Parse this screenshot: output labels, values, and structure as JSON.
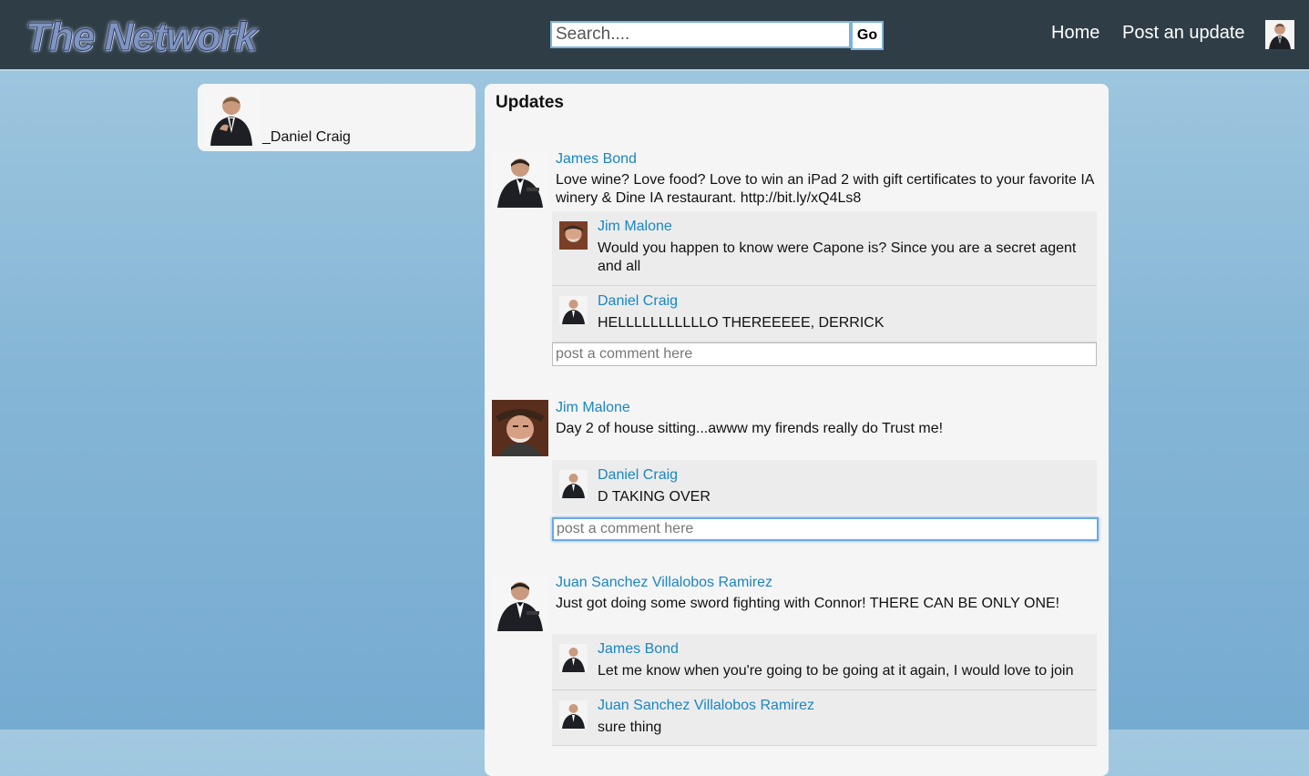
{
  "header": {
    "logo_text": "The Network",
    "search_placeholder": "Search....",
    "go_label": "Go",
    "nav_home": "Home",
    "nav_post": "Post an update",
    "avatar_icon": "user-avatar-icon"
  },
  "profile": {
    "name": "_Daniel Craig"
  },
  "updates": {
    "title": "Updates",
    "posts": [
      {
        "author": "James Bond",
        "text": "Love wine? Love food? Love to win an iPad 2 with gift certificates to your favorite IA winery & Dine IA restaurant. http://bit.ly/xQ4Ls8",
        "comments": [
          {
            "author": "Jim Malone",
            "text": "Would you happen to know were Capone is? Since you are a secret agent and all"
          },
          {
            "author": "Daniel Craig",
            "text": "HELLLLLLLLLLLO THEREEEEE, DERRICK"
          }
        ],
        "comment_placeholder": "post a comment here"
      },
      {
        "author": "Jim Malone",
        "text": "Day 2 of house sitting...awww my firends really do Trust me!",
        "comments": [
          {
            "author": "Daniel Craig",
            "text": "D TAKING OVER"
          }
        ],
        "comment_placeholder": "post a comment here"
      },
      {
        "author": "Juan Sanchez Villalobos Ramirez",
        "text": "Just got doing some sword fighting with Connor! THERE CAN BE ONLY ONE!",
        "comments": [
          {
            "author": "James Bond",
            "text": "Let me know when you're going to be going at it again, I would love to join"
          },
          {
            "author": "Juan Sanchez Villalobos Ramirez",
            "text": "sure thing"
          }
        ]
      }
    ]
  }
}
